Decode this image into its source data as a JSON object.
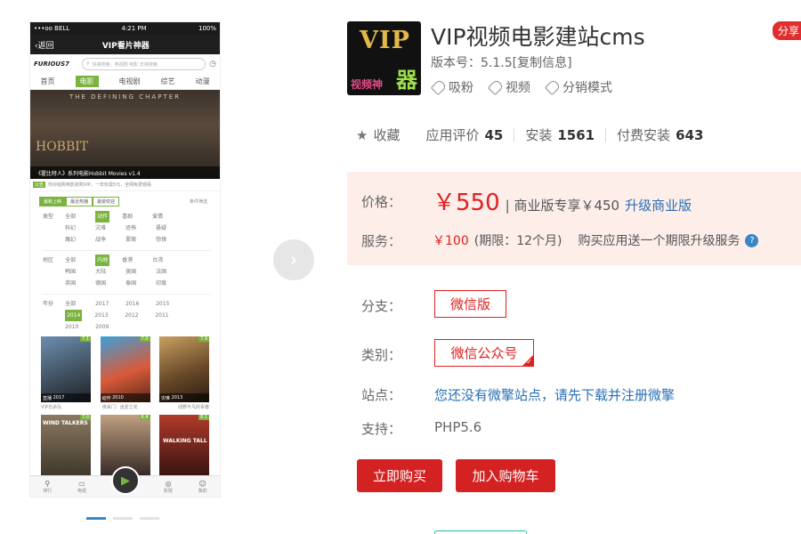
{
  "phone": {
    "status": {
      "carrier": "•••oo BELL",
      "time": "4:21 PM",
      "battery": "100%"
    },
    "nav": {
      "back": "返回",
      "title": "VIP看片神器"
    },
    "logo": "FURIOUS7",
    "search_placeholder": "快速搜索，电视剧 电影 支持搜索",
    "tabs": [
      "首页",
      "电影",
      "电视剧",
      "综艺",
      "动漫"
    ],
    "banner": {
      "top": "THE DEFINING CHAPTER",
      "hobbit": "HOBBIT",
      "caption": "《霍比特人》系列电影Hobbit Movies v1.4"
    },
    "notice": {
      "tag": "公告",
      "text": "你对给购电影抢购VIP，一年仅需5元，全网免费观看"
    },
    "filters": [
      "最新上映",
      "最近热播",
      "最受欢迎"
    ],
    "filter_right": "条件筛选",
    "grid": [
      {
        "label": "类型",
        "items": [
          "全部",
          "动作",
          "喜剧",
          "爱情",
          "科幻",
          "灾难",
          "恐怖",
          "悬疑",
          "魔幻",
          "战争",
          "罪案",
          "惊悚"
        ]
      },
      {
        "label": "地区",
        "items": [
          "全部",
          "内地",
          "香港",
          "台湾",
          "韩国",
          "大陆",
          "美国",
          "法国",
          "英国",
          "德国",
          "泰国",
          "印度"
        ]
      },
      {
        "label": "年份",
        "items": [
          "全部",
          "2017",
          "2016",
          "2015",
          "2014",
          "2013",
          "2012",
          "2011",
          "2010",
          "2009"
        ]
      }
    ],
    "posters": [
      {
        "name": "直播",
        "year": "2017",
        "score": "7.1",
        "title": "V字仇杀队"
      },
      {
        "name": "动作",
        "year": "2010",
        "score": "7.0",
        "title": "夜来门：迷爱之花"
      },
      {
        "name": "灾难",
        "year": "2013",
        "score": "7.9",
        "title": "绿野不凡的青春"
      }
    ],
    "posters2": [
      {
        "name": "WIND TALKERS",
        "score": "7.0"
      },
      {
        "name": "",
        "score": "6.4"
      },
      {
        "name": "WALKING TALL",
        "score": "8.1"
      }
    ],
    "bottom": [
      "排行",
      "电视",
      "",
      "影院",
      "我的"
    ]
  },
  "app": {
    "name": "VIP视频电影建站cms",
    "version": "版本号：5.1.5[复制信息]",
    "share": "分享",
    "icon": {
      "vip": "VIP",
      "sub": "视频神",
      "qi": "器"
    },
    "tags": [
      "吸粉",
      "视频",
      "分销模式"
    ]
  },
  "stats": {
    "favorite": "收藏",
    "rating_label": "应用评价",
    "rating": "45",
    "install_label": "安装",
    "install": "1561",
    "paid_label": "付费安装",
    "paid": "643"
  },
  "price": {
    "label": "价格：",
    "value": "￥550",
    "pro": "| 商业版专享￥450",
    "upgrade": "升级商业版",
    "service_label": "服务：",
    "service_value": "￥100",
    "service_period": "(期限：12个月)",
    "service_note": "购买应用送一个期限升级服务",
    "help": "?"
  },
  "options": {
    "branch_label": "分支：",
    "branch": "微信版",
    "category_label": "类别：",
    "category": "微信公众号",
    "site_label": "站点：",
    "site_link": "您还没有微擎站点，请先下载并注册微擎",
    "support_label": "支持：",
    "support": "PHP5.6"
  },
  "buttons": {
    "buy": "立即购买",
    "cart": "加入购物车"
  }
}
